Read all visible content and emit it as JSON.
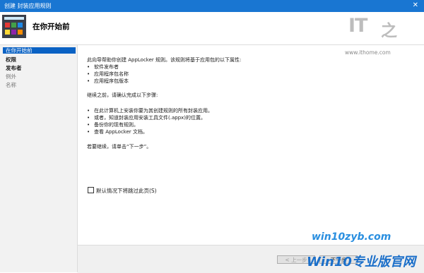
{
  "window": {
    "title": "创建 封装应用规则",
    "close_glyph": "✕"
  },
  "header": {
    "title": "在你开始前"
  },
  "brand": {
    "logo_it": "IT",
    "logo_zhi": "之",
    "logo_url": "www.ithome.com"
  },
  "sidebar": {
    "items": [
      {
        "label": "在你开始前"
      },
      {
        "label": "权限"
      },
      {
        "label": "发布者"
      },
      {
        "label": "例外"
      },
      {
        "label": "名称"
      }
    ]
  },
  "main": {
    "intro": "此向导帮助你创建 AppLocker 规则。该规则将基于应用包的以下属性:",
    "props": [
      "软件发布者",
      "应用程序包名称",
      "应用程序包版本"
    ],
    "steps_intro": "继续之前，请确认完成以下步骤:",
    "steps": [
      "在此计算机上安装你要为其创建规则的所有封装应用。",
      "或者，知道封装应用安装工具文件(.appx)的位置。",
      "备份你的现有规则。",
      "查看 AppLocker 文档。"
    ],
    "continue_text": "若要继续，请单击“下一步”。",
    "bullet": "•",
    "skip_checkbox_label": "默认情况下将跳过此页(S)"
  },
  "footer": {
    "prev_label": "< 上一步",
    "next_label": "下一步"
  },
  "watermark": {
    "site": "win10zyb.com",
    "logo": "Win10专业版官网"
  }
}
